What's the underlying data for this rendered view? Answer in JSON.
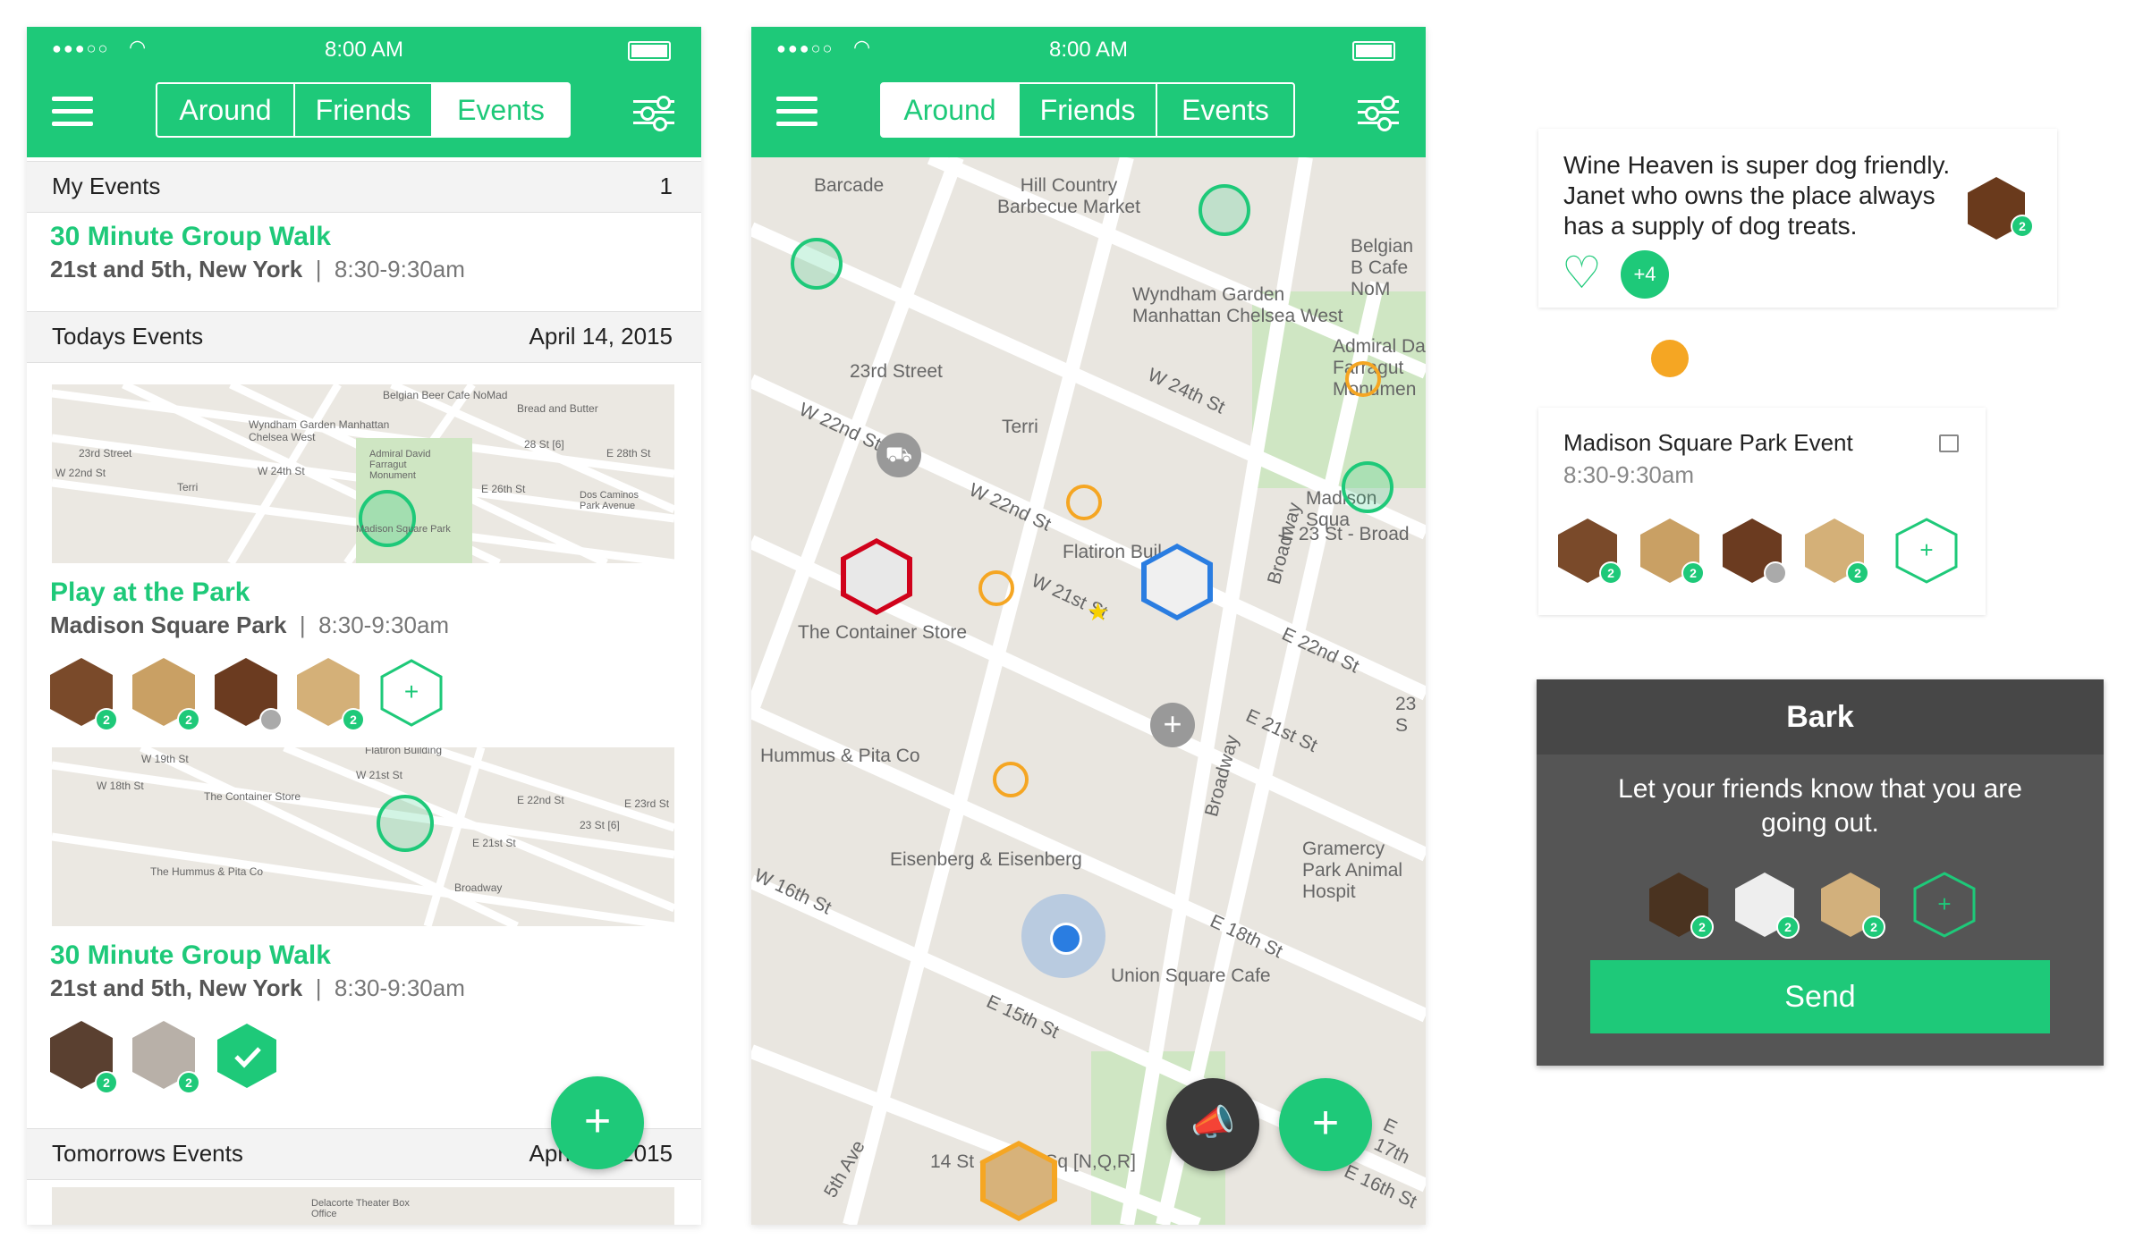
{
  "status": {
    "time": "8:00 AM",
    "signal": "●●●○○"
  },
  "tabs": [
    "Around",
    "Friends",
    "Events"
  ],
  "events_screen": {
    "my_events": {
      "label": "My Events",
      "count": "1"
    },
    "my_event": {
      "title": "30 Minute Group Walk",
      "location": "21st and 5th, New York",
      "time": "8:30-9:30am"
    },
    "todays": {
      "label": "Todays Events",
      "date": "April 14, 2015"
    },
    "event1": {
      "title": "Play at the Park",
      "location": "Madison Square Park",
      "time": "8:30-9:30am"
    },
    "event2": {
      "title": "30 Minute Group Walk",
      "location": "21st and 5th, New York",
      "time": "8:30-9:30am"
    },
    "tomorrows": {
      "label": "Tomorrows Events",
      "date": "April 15, 2015"
    },
    "map1_labels": [
      "Belgian Beer Cafe NoMad",
      "Wyndham Garden Manhattan Chelsea West",
      "Bread and Butter",
      "23rd Street",
      "Admiral David Farragut Monument",
      "28 St [6]",
      "W 22nd St",
      "Terri",
      "Madison Square Park",
      "Dos Caminos Park Avenue",
      "W 24th St",
      "E 26th St",
      "E 28th St"
    ],
    "map2_labels": [
      "W 19th St",
      "Flatiron Building",
      "W 18th St",
      "The Container Store",
      "W 21st St",
      "E 22nd St",
      "23 St [6]",
      "E 23rd St",
      "The Hummus & Pita Co",
      "E 21st St",
      "Broadway"
    ],
    "map3_labels": [
      "Delacorte Theater Box Office"
    ]
  },
  "map_screen": {
    "labels": [
      "Barcade",
      "Hill Country Barbecue Market",
      "Belgian B Cafe NoM",
      "Wyndham Garden Manhattan Chelsea West",
      "23rd Street",
      "W 22nd St",
      "W 24th St",
      "Admiral Da Farragut Monumen",
      "Terri",
      "W 22nd St",
      "Madison Squa",
      "Broadway",
      "Flatiron Buil",
      "E 23 St - Broad",
      "W 21st St",
      "The Container Store",
      "E 22nd St",
      "E 21st St",
      "23 S",
      "Hummus & Pita Co",
      "Broadway",
      "Eisenberg & Eisenberg",
      "Gramercy Park Animal Hospit",
      "W 16th St",
      "E 18th St",
      "Union Square Cafe",
      "E 15th St",
      "14 St - Union Sq [N,Q,R]",
      "5th Ave",
      "E 16th St",
      "E 17th"
    ]
  },
  "comment_card": {
    "text": "Wine Heaven is super dog friendly. Janet who owns the place always has a supply of dog treats.",
    "extra": "+4",
    "badge": "2"
  },
  "event_card": {
    "title": "Madison Square Park Event",
    "time": "8:30-9:30am"
  },
  "bark_dialog": {
    "title": "Bark",
    "message": "Let your friends know that you are going out.",
    "button": "Send"
  },
  "badge_count": "2",
  "colors": {
    "brand": "#1ec979",
    "orange": "#f5a623",
    "dark": "#555555"
  }
}
